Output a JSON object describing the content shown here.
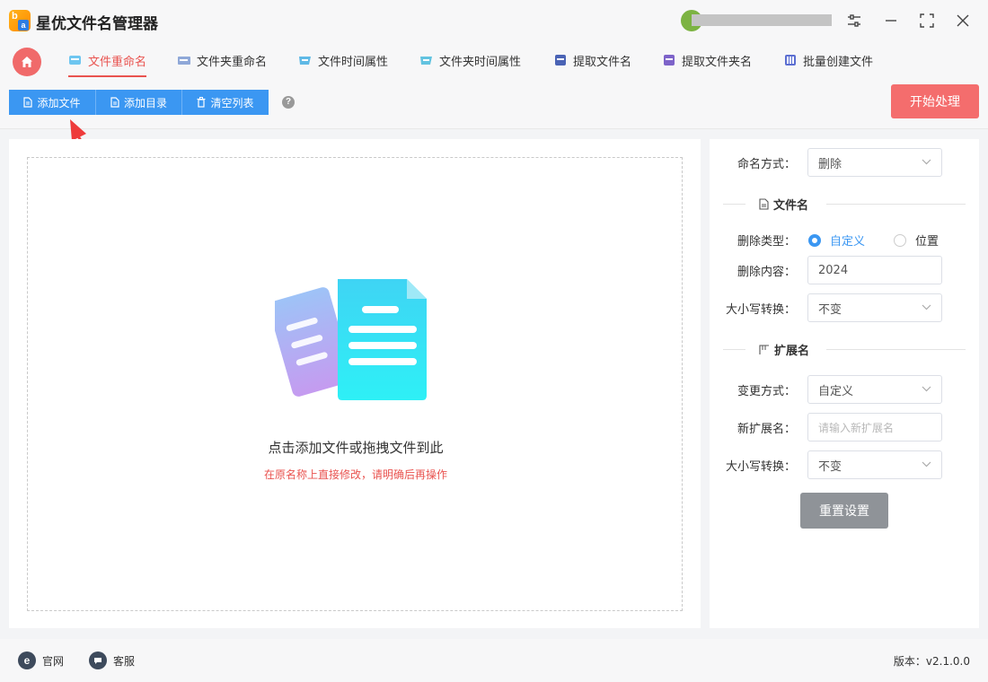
{
  "app": {
    "title": "星优文件名管理器",
    "logo_letters": [
      "b",
      "a"
    ]
  },
  "tabs": [
    {
      "label": "文件重命名",
      "active": true
    },
    {
      "label": "文件夹重命名",
      "active": false
    },
    {
      "label": "文件时间属性",
      "active": false
    },
    {
      "label": "文件夹时间属性",
      "active": false
    },
    {
      "label": "提取文件名",
      "active": false
    },
    {
      "label": "提取文件夹名",
      "active": false
    },
    {
      "label": "批量创建文件",
      "active": false
    }
  ],
  "toolbar": {
    "add_file": "添加文件",
    "add_dir": "添加目录",
    "clear_list": "清空列表",
    "help": "?",
    "start": "开始处理"
  },
  "dropzone": {
    "main_text": "点击添加文件或拖拽文件到此",
    "warning": "在原名称上直接修改，请明确后再操作"
  },
  "settings": {
    "naming_method_label": "命名方式：",
    "naming_method_value": "删除",
    "filename_section": "文件名",
    "delete_type_label": "删除类型：",
    "delete_type_options": [
      "自定义",
      "位置"
    ],
    "delete_type_selected": "自定义",
    "delete_content_label": "删除内容：",
    "delete_content_value": "2024",
    "case_label": "大小写转换：",
    "case_value": "不变",
    "ext_section": "扩展名",
    "change_method_label": "变更方式：",
    "change_method_value": "自定义",
    "new_ext_label": "新扩展名：",
    "new_ext_placeholder": "请输入新扩展名",
    "ext_case_label": "大小写转换：",
    "ext_case_value": "不变",
    "reset": "重置设置"
  },
  "footer": {
    "website": "官网",
    "support": "客服",
    "version": "版本：v2.1.0.0"
  },
  "colors": {
    "accent_blue": "#3b97f2",
    "accent_red": "#e9534f",
    "start_button": "#f46d6d",
    "reset_button": "#8f9398"
  },
  "icons": {
    "home": "home-icon",
    "file": "document-icon",
    "settings": "sliders-icon",
    "minimize": "minimize-icon",
    "maximize": "maximize-icon",
    "close": "close-icon"
  }
}
